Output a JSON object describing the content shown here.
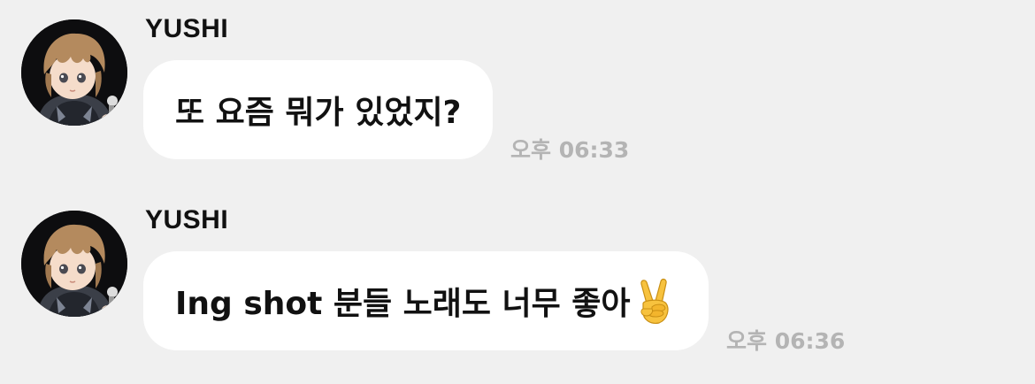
{
  "messages": [
    {
      "sender": "YUSHI",
      "text": "또 요즘 뭐가 있었지?",
      "time": "오후 06:33"
    },
    {
      "sender": "YUSHI",
      "text": "Ing shot 분들 노래도 너무 좋아",
      "emoji": "victory-hand-emoji",
      "time": "오후 06:36"
    }
  ],
  "colors": {
    "background": "#f0f0f0",
    "bubble": "#ffffff",
    "timestamp": "#b4b4b4"
  }
}
